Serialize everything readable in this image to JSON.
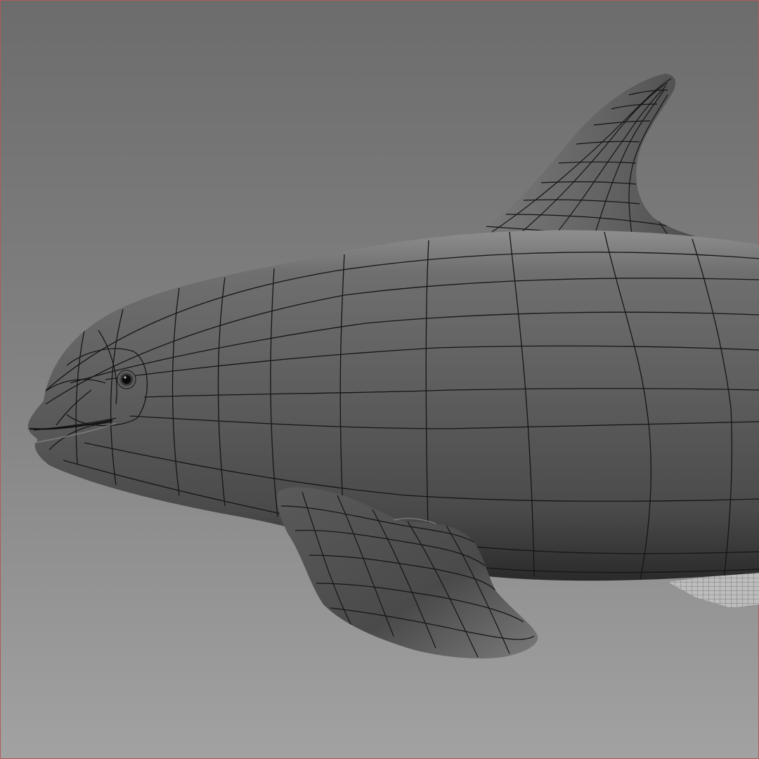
{
  "viewport": {
    "background_top": "#6d6d6d",
    "background_bottom": "#a3a3a3",
    "frame_border_color": "#b35a5a"
  },
  "model": {
    "kind": "dolphin-mesh",
    "shading": "smooth-shaded-with-wireframe",
    "body_color": "#5e5e5e",
    "wire_color": "#151515",
    "highlight_color": "#9a9a9a"
  }
}
